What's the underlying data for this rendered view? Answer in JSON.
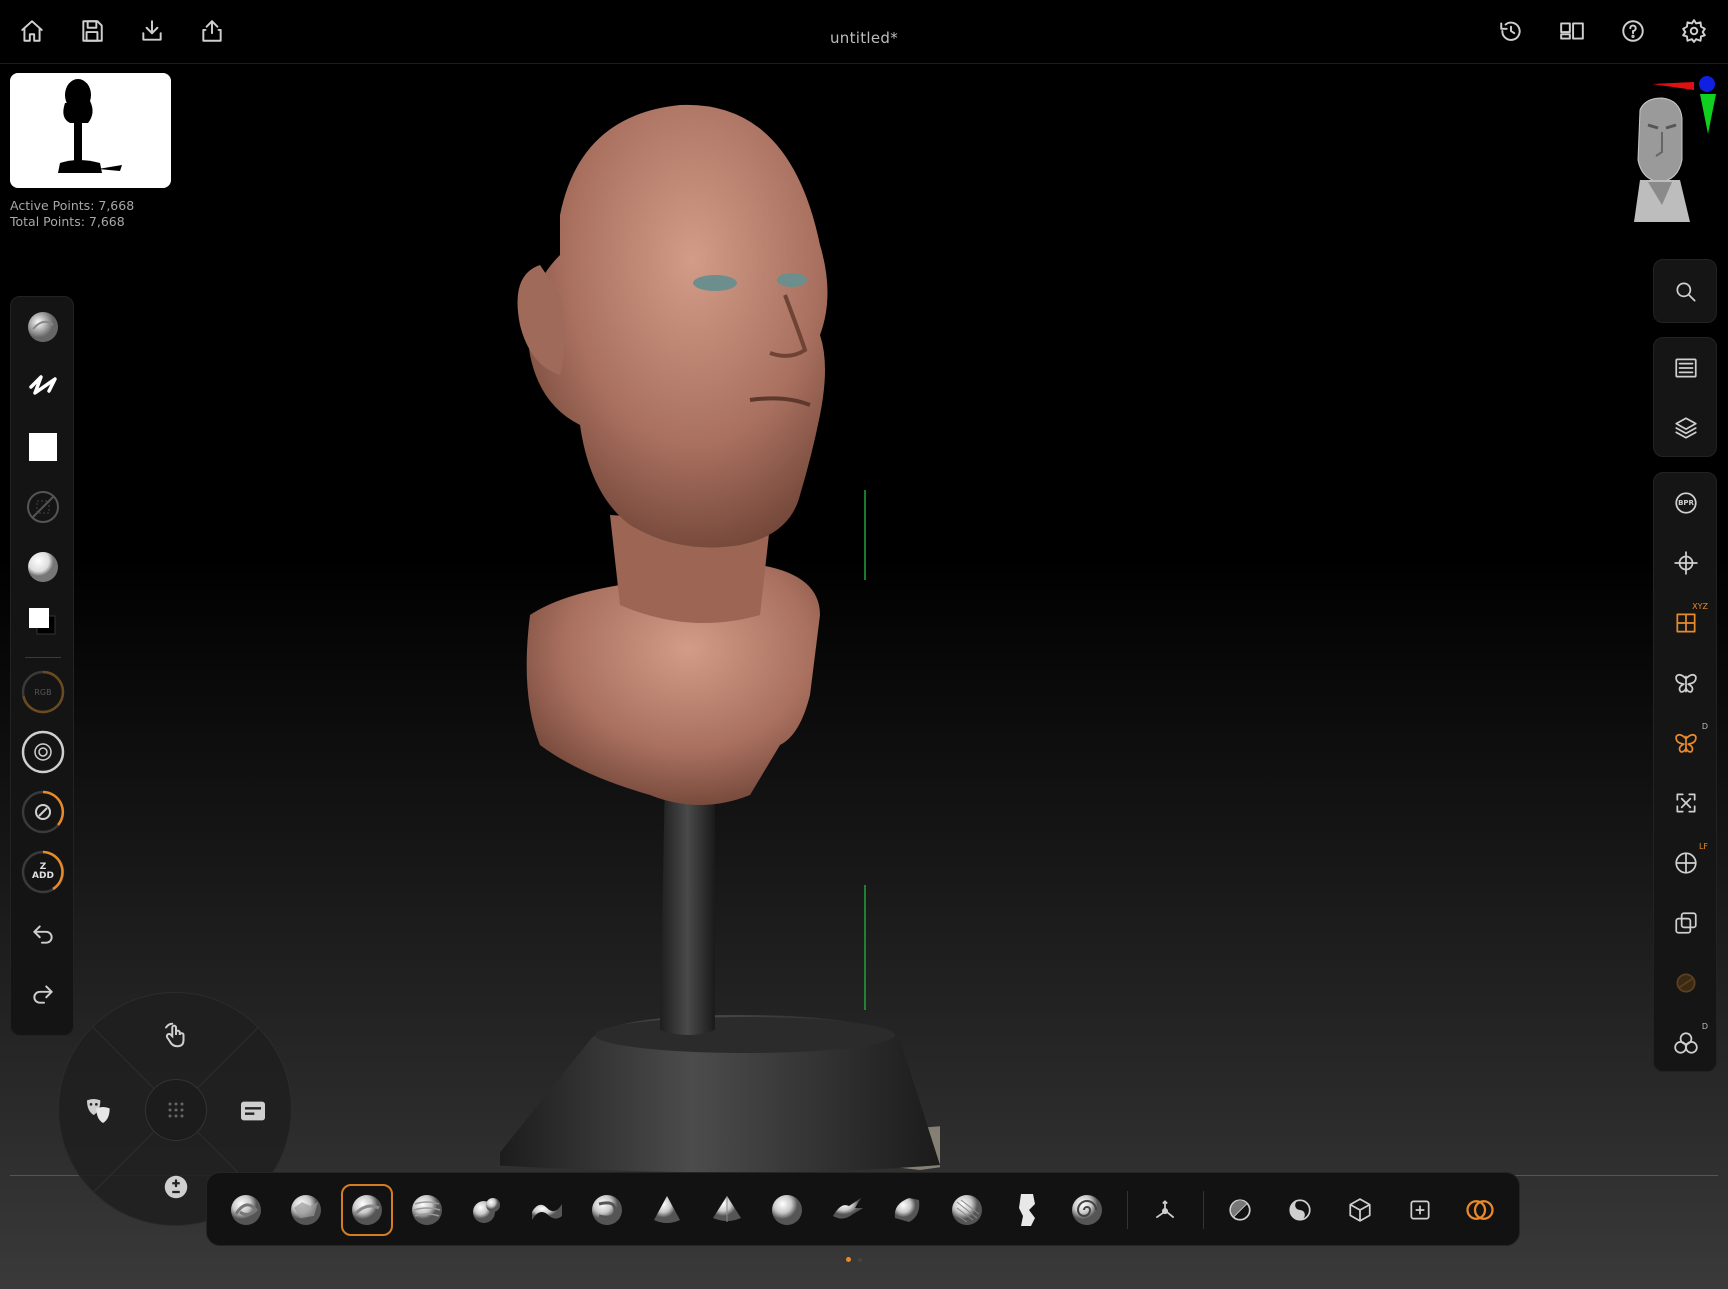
{
  "app": {
    "document_title": "untitled*"
  },
  "topbar": {
    "left_icons": [
      "home-icon",
      "save-icon",
      "import-icon",
      "share-icon"
    ],
    "right_icons": [
      "history-icon",
      "layout-icon",
      "help-icon",
      "settings-icon"
    ]
  },
  "stats": {
    "active_points": "Active Points: 7,668",
    "total_points": "Total Points: 7,668"
  },
  "left_toolbar": {
    "items": [
      "brush-sphere-icon",
      "stroke-icon",
      "alpha-square-icon",
      "texture-off-icon",
      "material-sphere-icon",
      "color-swatch-icon",
      "rgb-dial",
      "focal-shift-dial",
      "draw-size-dial",
      "z-intensity-dial",
      "undo-icon",
      "redo-icon"
    ],
    "rgb_label": "RGB",
    "zadd_label_top": "Z",
    "zadd_label_bottom": "ADD"
  },
  "right_toolbar": {
    "search": "search-icon",
    "group1": [
      "subtools-icon",
      "layers-icon"
    ],
    "group2": [
      {
        "icon": "bpr-icon",
        "sup": ""
      },
      {
        "icon": "move-gizmo-icon",
        "sup": ""
      },
      {
        "icon": "floor-grid-icon",
        "sup": "XYZ"
      },
      {
        "icon": "symmetry-icon",
        "sup": ""
      },
      {
        "icon": "radial-symmetry-icon",
        "sup": "D"
      },
      {
        "icon": "frame-icon",
        "sup": ""
      },
      {
        "icon": "perspective-icon",
        "sup": "LF"
      },
      {
        "icon": "transparency-icon",
        "sup": ""
      },
      {
        "icon": "solo-icon",
        "sup": ""
      },
      {
        "icon": "polyframe-icon",
        "sup": "D"
      }
    ],
    "bpr_label": "BPR"
  },
  "radial_menu": {
    "items": [
      "gesture-icon",
      "masks-icon",
      "menu-icon",
      "add-subtract-icon",
      "grid-icon"
    ]
  },
  "brush_bar": {
    "brushes": [
      "move-brush",
      "clay-brush",
      "standard-brush",
      "claybuildup-brush",
      "inflate-brush",
      "smooth-brush",
      "dam-standard-brush",
      "trim-dynamic-brush",
      "hpolish-brush",
      "pinch-brush",
      "snakehook-brush",
      "flatten-brush",
      "curve-brush",
      "sculpt-figure-brush",
      "spiral-brush"
    ],
    "selected_index": 2,
    "tools": [
      "gizmo-tool",
      "mask-tool",
      "select-tool",
      "slice-tool",
      "trim-tool",
      "dynamesh-tool"
    ]
  },
  "colors": {
    "accent": "#e88a2a",
    "background": "#000000",
    "clay": "#b98372"
  }
}
